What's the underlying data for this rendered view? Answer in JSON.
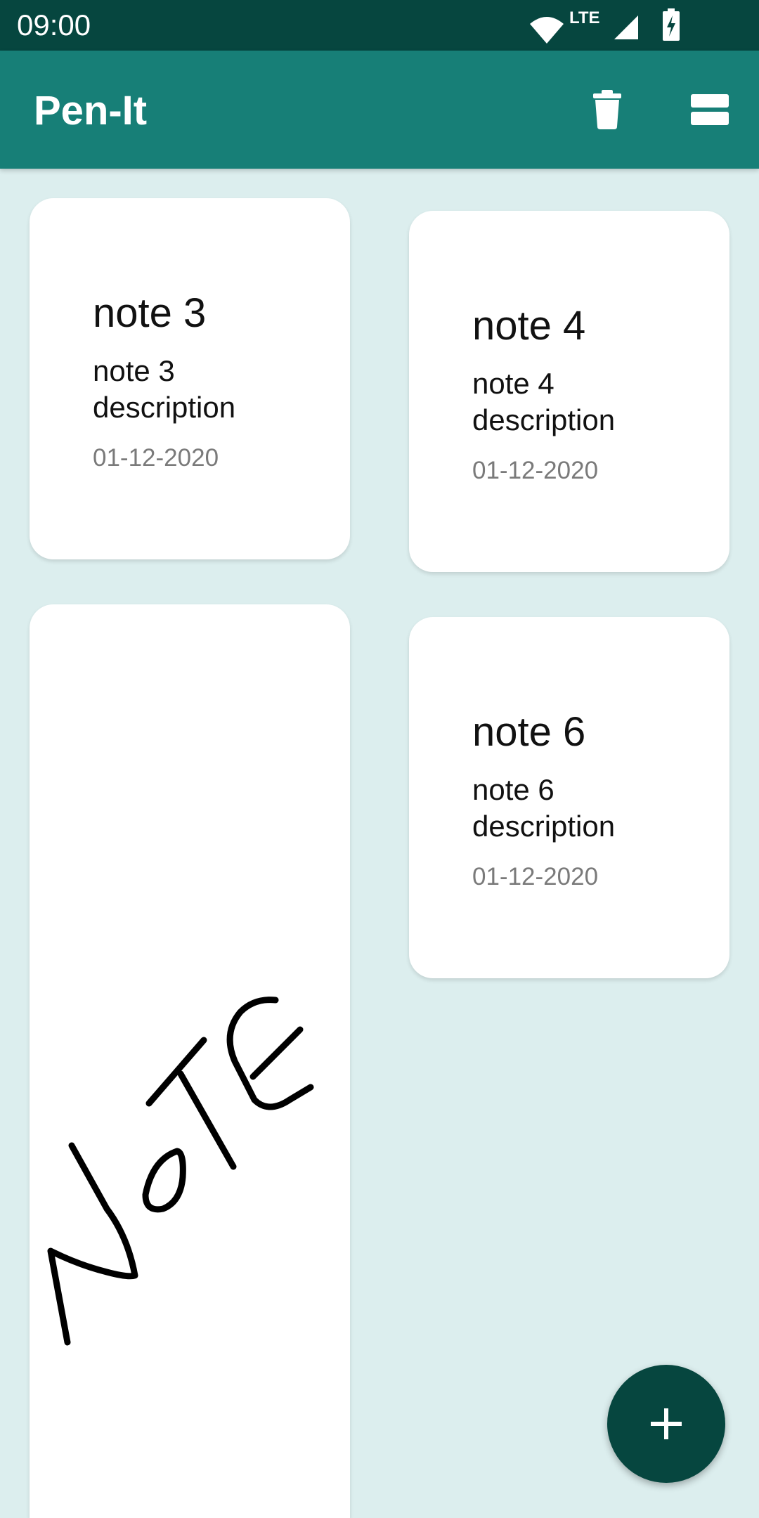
{
  "status_bar": {
    "time": "09:00",
    "network_label": "LTE",
    "icons": [
      "wifi-icon",
      "cell-signal-icon",
      "battery-charging-icon"
    ]
  },
  "app_bar": {
    "title": "Pen-It",
    "actions": [
      {
        "name": "delete-all-button",
        "icon": "trash-icon"
      },
      {
        "name": "layout-toggle-button",
        "icon": "view-agenda-icon"
      }
    ],
    "color": "#177f77"
  },
  "notes": [
    {
      "title": "note 3",
      "description": "note 3 description",
      "date": "01-12-2020"
    },
    {
      "title": "note 4",
      "description": "note 4 description",
      "date": "01-12-2020"
    },
    {
      "title": "",
      "description": "",
      "date": "",
      "drawing": "handwritten NOTE"
    },
    {
      "title": "note 6",
      "description": "note 6 description",
      "date": "01-12-2020"
    }
  ],
  "fab": {
    "icon": "plus-icon",
    "color": "#06463f"
  },
  "colors": {
    "status_bar": "#06463f",
    "background": "#dceeee",
    "card": "#ffffff",
    "date_text": "#7a7a7a"
  }
}
